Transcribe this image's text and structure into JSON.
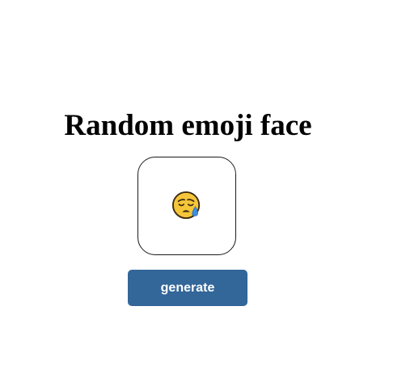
{
  "page": {
    "title": "Random emoji face"
  },
  "emoji_display": {
    "icon": "sad-relieved-face-with-sweat-drop-icon",
    "colors": {
      "face": "#f5c63a",
      "face_outline": "#3b2a10",
      "tear": "#3d8fe0"
    }
  },
  "controls": {
    "generate_label": "generate",
    "accent_color": "#336699"
  }
}
